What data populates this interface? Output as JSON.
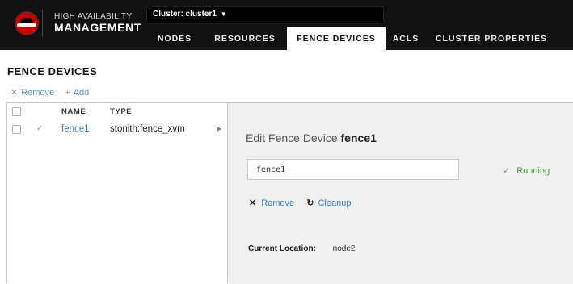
{
  "header": {
    "brand_top": "HIGH AVAILABILITY",
    "brand_bottom": "MANAGEMENT",
    "cluster_selector": "Cluster: cluster1",
    "tabs": [
      {
        "label": "NODES",
        "active": false
      },
      {
        "label": "RESOURCES",
        "active": false
      },
      {
        "label": "FENCE DEVICES",
        "active": true
      },
      {
        "label": "ACLS",
        "active": false
      },
      {
        "label": "CLUSTER PROPERTIES",
        "active": false
      }
    ]
  },
  "page": {
    "title": "FENCE DEVICES",
    "remove_label": "Remove",
    "add_label": "Add"
  },
  "list": {
    "columns": {
      "name": "NAME",
      "type": "TYPE"
    },
    "rows": [
      {
        "name": "fence1",
        "type": "stonith:fence_xvm"
      }
    ]
  },
  "detail": {
    "title_prefix": "Edit Fence Device",
    "title_name": "fence1",
    "name_value": "fence1",
    "status": "Running",
    "remove_label": "Remove",
    "cleanup_label": "Cleanup",
    "location_label": "Current Location:",
    "location_value": "node2"
  },
  "colors": {
    "header_bg": "#111111",
    "link": "#3a7fc1",
    "status_green": "#3f9c35",
    "detail_bg": "#f0f0f0",
    "brand_red": "#cc0000"
  },
  "icons": [
    "redhat-logo",
    "chevron-down-icon",
    "close-icon",
    "plus-icon",
    "checkmark-icon",
    "chevron-right-icon",
    "refresh-icon"
  ]
}
